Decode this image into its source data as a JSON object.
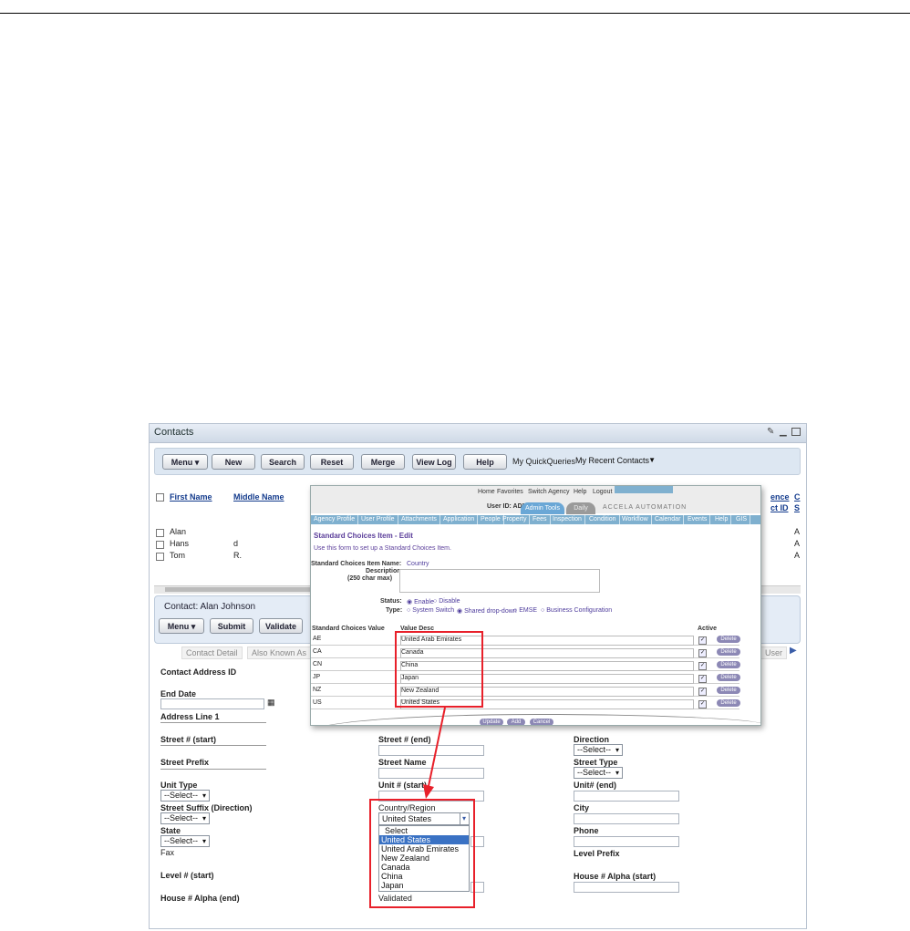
{
  "portlet": {
    "title": "Contacts",
    "toolbar": {
      "menu": "Menu",
      "new": "New",
      "search": "Search",
      "reset": "Reset",
      "merge": "Merge",
      "view_log": "View Log",
      "help": "Help",
      "quickqueries_label": "My QuickQueries",
      "quickqueries_value": "My Recent Contacts"
    },
    "list": {
      "col_first": "First Name",
      "col_middle": "Middle Name",
      "col_right1a": "ence",
      "col_right1b": "ct ID",
      "col_right2a": "C",
      "col_right2b": "S",
      "rows": [
        {
          "first": "Alan",
          "middle": "",
          "right": "A"
        },
        {
          "first": "Hans",
          "middle": "d",
          "right": "A"
        },
        {
          "first": "Tom",
          "middle": "R.",
          "right": "A"
        }
      ]
    },
    "detail": {
      "title": "Contact: Alan Johnson",
      "menu": "Menu",
      "submit": "Submit",
      "validate": "Validate"
    },
    "tabs": [
      "Contact Detail",
      "Also Known As",
      "User"
    ],
    "form": {
      "contact_address_id": "Contact Address ID",
      "end_date": "End Date",
      "address_line_1": "Address Line 1",
      "street_start": "Street # (start)",
      "street_prefix": "Street Prefix",
      "unit_type": "Unit Type",
      "street_suffix": "Street Suffix (Direction)",
      "state": "State",
      "fax": "Fax",
      "level_start": "Level # (start)",
      "house_alpha_end": "House # Alpha (end)",
      "street_end": "Street # (end)",
      "street_name": "Street Name",
      "unit_start": "Unit # (start)",
      "country_region": "Country/Region",
      "direction": "Direction",
      "street_type": "Street Type",
      "unit_end": "Unit# (end)",
      "city": "City",
      "phone": "Phone",
      "level_prefix": "Level Prefix",
      "house_alpha_start": "House # Alpha (start)",
      "select_placeholder": "--Select--",
      "country_value": "United States",
      "validated": "Validated"
    },
    "country_options": [
      "Select",
      "United States",
      "United Arab Emirates",
      "New Zealand",
      "Canada",
      "China",
      "Japan"
    ]
  },
  "overlay": {
    "top_links": [
      "Home",
      "Favorites",
      "Switch Agency",
      "Help",
      "Logout"
    ],
    "user_id": "User ID: ADMIN",
    "tab_admin": "Admin Tools",
    "tab_daily": "Daily",
    "brand": "ACCELA AUTOMATION",
    "nav": [
      "Agency Profile",
      "User Profile",
      "Attachments",
      "Application",
      "People",
      "Property",
      "Fees",
      "Inspection",
      "Condition",
      "Workflow",
      "Calendar",
      "Events",
      "Help",
      "GIS"
    ],
    "heading": "Standard Choices Item - Edit",
    "subheading": "Use this form to set up a Standard Choices Item.",
    "item_name_label": "Standard Choices Item Name:",
    "item_name_value": "Country",
    "description_label": "Description:",
    "description_hint": "(250 char max)",
    "status_label": "Status:",
    "status_enable": "Enable",
    "status_disable": "Disable",
    "type_label": "Type:",
    "type_options": [
      "System Switch",
      "Shared drop-down",
      "EMSE",
      "Business Configuration"
    ],
    "col_value": "Standard Choices Value",
    "col_desc": "Value Desc",
    "col_active": "Active",
    "delete_label": "Delete",
    "rows": [
      {
        "value": "AE",
        "desc": "United Arab Emirates"
      },
      {
        "value": "CA",
        "desc": "Canada"
      },
      {
        "value": "CN",
        "desc": "China"
      },
      {
        "value": "JP",
        "desc": "Japan"
      },
      {
        "value": "NZ",
        "desc": "New Zealand"
      },
      {
        "value": "US",
        "desc": "United States"
      }
    ],
    "buttons": {
      "update": "Update",
      "add": "Add",
      "cancel": "Cancel"
    }
  },
  "colors": {
    "accent_red": "#e8202a",
    "nav_blue": "#7fb0cf",
    "purple": "#5b3e9a"
  }
}
